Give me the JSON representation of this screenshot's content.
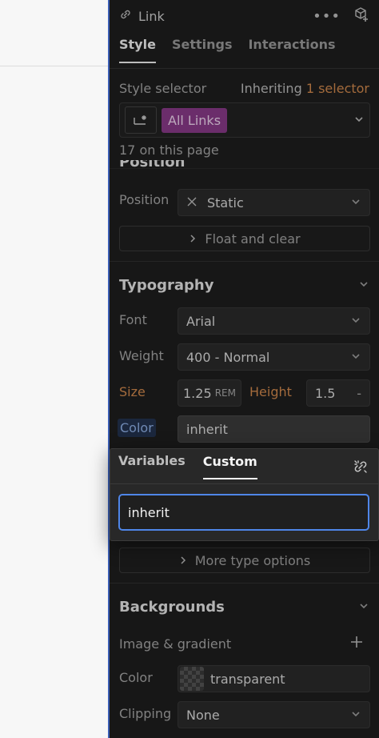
{
  "header": {
    "element_name": "Link",
    "icons": {
      "link": "link-icon",
      "more": "more-icon",
      "add_component": "add-component-icon"
    }
  },
  "tabs": [
    {
      "label": "Style",
      "active": true
    },
    {
      "label": "Settings",
      "active": false
    },
    {
      "label": "Interactions",
      "active": false
    }
  ],
  "style_selector": {
    "label": "Style selector",
    "inheriting_prefix": "Inheriting",
    "inheriting_count": "1 selector",
    "chip_label": "All Links",
    "count_text": "17 on this page"
  },
  "position": {
    "section_title_partial": "Position",
    "label": "Position",
    "value": "Static",
    "float_button": "Float and clear"
  },
  "typography": {
    "title": "Typography",
    "font_label": "Font",
    "font_value": "Arial",
    "weight_label": "Weight",
    "weight_value": "400 - Normal",
    "size_label": "Size",
    "size_value": "1.25",
    "size_unit": "REM",
    "height_label": "Height",
    "height_value": "1.5",
    "height_unit": "-",
    "color_label": "Color",
    "color_value": "inherit",
    "more_options": "More type options"
  },
  "color_popover": {
    "tabs": [
      {
        "label": "Variables",
        "active": false
      },
      {
        "label": "Custom",
        "active": true
      }
    ],
    "input_value": "inherit"
  },
  "backgrounds": {
    "title": "Backgrounds",
    "image_label": "Image & gradient",
    "color_label": "Color",
    "color_value": "transparent",
    "clipping_label": "Clipping",
    "clipping_value": "None"
  },
  "colors": {
    "panel_bg": "#1e1e1e",
    "accent_blue": "#4f86e8",
    "chip_purple": "#8a3a8a",
    "orange_label": "#d28a4e"
  }
}
